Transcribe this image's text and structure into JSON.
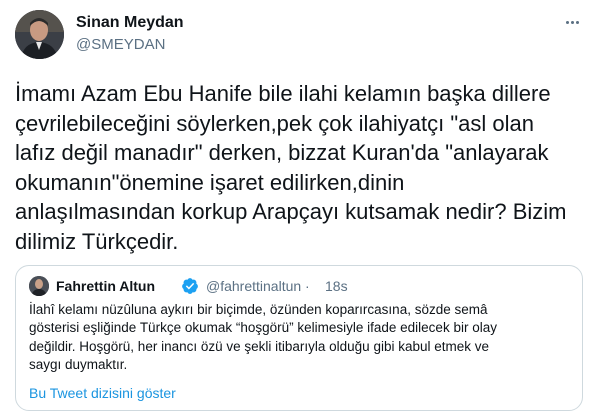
{
  "author": {
    "name": "Sinan Meydan",
    "handle": "@SMEYDAN"
  },
  "tweet_text": "İmamı Azam Ebu Hanife bile ilahi kelamın başka dillere\nçevrilebileceğini söylerken,pek çok ilahiyatçı \"asl olan\nlafız değil manadır\" derken, bizzat Kuran'da \"anlayarak\nokumanın\"önemine işaret edilirken,dinin\nanlaşılmasından korkup Arapçayı kutsamak nedir? Bizim\ndilimiz Türkçedir.",
  "quoted_tweet": {
    "name": "Fahrettin Altun",
    "handle": "@fahrettinaltun",
    "separator": "·",
    "time": "18s",
    "text": "İlahî kelamı nüzûluna aykırı bir biçimde, özünden koparırcasına, sözde semâ\ngösterisi eşliğinde Türkçe okumak “hoşgörü” kelimesiyle ifade edilecek bir olay\ndeğildir. Hoşgörü, her inancı özü ve şekli itibarıyla olduğu gibi kabul etmek ve\nsaygı duymaktır.",
    "thread_link": "Bu Tweet dizisini göster"
  },
  "colors": {
    "text": "#0f1419",
    "secondary": "#5b7083",
    "link": "#1b95e0",
    "border": "#cfd9de",
    "verified": "#1da1f2"
  },
  "icons": {
    "more": "more-dots-icon",
    "verified": "verified-badge-icon"
  }
}
